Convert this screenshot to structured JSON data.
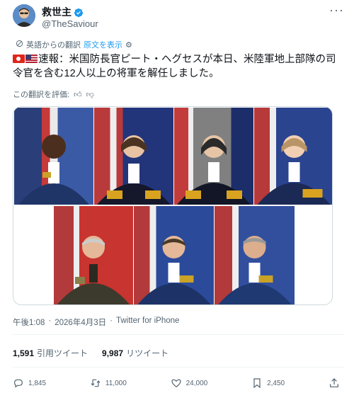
{
  "user": {
    "display_name": "救世主",
    "handle": "@TheSaviour",
    "avatar": "avatar-icon"
  },
  "translation": {
    "label": "英語からの翻訳",
    "show_original": "原文を表示",
    "rate_label": "この翻訳を評価:"
  },
  "tweet": {
    "text": "速報：米国防長官ピート・ヘグセスが本日、米陸軍地上部隊の司令官を含む12人以上の将軍を解任しました。"
  },
  "meta": {
    "time": "午後1:08",
    "date": "2026年4月3日",
    "source": "Twitter for iPhone"
  },
  "stats": {
    "quotes_count": "1,591",
    "quotes_label": "引用ツイート",
    "retweets_count": "9,987",
    "retweets_label": "リツイート"
  },
  "actions": {
    "reply": "1,845",
    "retweet": "11,000",
    "like": "24,000",
    "bookmark": "2,450"
  },
  "colors": {
    "accent": "#1d9bf0",
    "muted": "#536471"
  }
}
